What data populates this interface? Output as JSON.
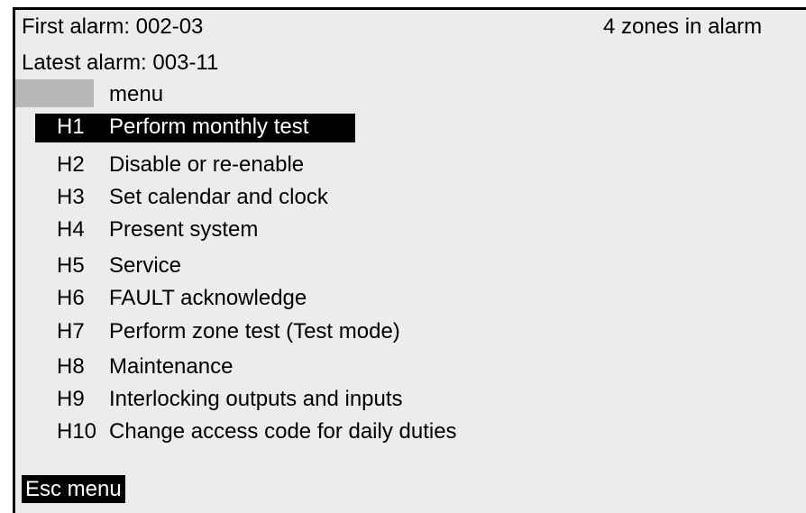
{
  "header": {
    "first_alarm": "First alarm: 002-03",
    "zones_in_alarm": "4 zones in alarm",
    "latest_alarm": "Latest alarm: 003-11"
  },
  "menu": {
    "title": "menu",
    "selected_code": "H1",
    "items": [
      {
        "code": "H1",
        "label": "Perform monthly test"
      },
      {
        "code": "H2",
        "label": "Disable or re-enable"
      },
      {
        "code": "H3",
        "label": "Set calendar and clock"
      },
      {
        "code": "H4",
        "label": "Present system"
      },
      {
        "code": "H5",
        "label": "Service"
      },
      {
        "code": "H6",
        "label": "FAULT acknowledge"
      },
      {
        "code": "H7",
        "label": "Perform zone test (Test mode)"
      },
      {
        "code": "H8",
        "label": "Maintenance"
      },
      {
        "code": "H9",
        "label": "Interlocking outputs and inputs"
      },
      {
        "code": "H10",
        "label": "Change access code for daily duties"
      }
    ]
  },
  "footer": {
    "esc_label": "Esc menu"
  },
  "colors": {
    "background": "#ececec",
    "highlight": "#000000",
    "highlight_text": "#ffffff",
    "menu_block": "#b8b8b8"
  }
}
